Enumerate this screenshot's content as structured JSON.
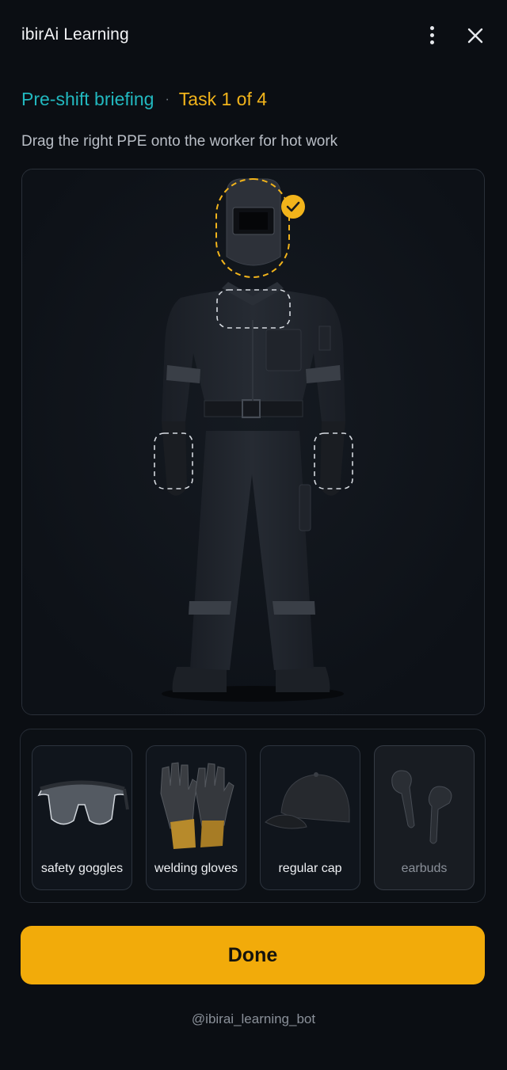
{
  "header": {
    "app_title": "ibirAi Learning",
    "menu_icon": "vertical-ellipsis-icon",
    "close_icon": "close-icon"
  },
  "breadcrumb": {
    "section": "Pre-shift briefing",
    "separator": "·",
    "task": "Task 1 of 4"
  },
  "instruction": "Drag the right PPE onto the worker for hot work",
  "worker": {
    "drop_zones": [
      {
        "slot": "head",
        "filled_with": "welding helmet",
        "status": "correct"
      },
      {
        "slot": "chest",
        "filled_with": null
      },
      {
        "slot": "left-hand",
        "filled_with": null
      },
      {
        "slot": "right-hand",
        "filled_with": null
      }
    ]
  },
  "items": [
    {
      "label": "safety goggles",
      "icon": "safety-goggles-icon",
      "dimmed": false
    },
    {
      "label": "welding gloves",
      "icon": "welding-gloves-icon",
      "dimmed": false
    },
    {
      "label": "regular cap",
      "icon": "baseball-cap-icon",
      "dimmed": false
    },
    {
      "label": "earbuds",
      "icon": "earbuds-icon",
      "dimmed": true
    }
  ],
  "done_label": "Done",
  "footer": "@ibirai_learning_bot",
  "colors": {
    "accent_teal": "#22b8bf",
    "accent_amber": "#f2b41b",
    "button": "#f2ab0a",
    "background": "#0b0e13"
  }
}
